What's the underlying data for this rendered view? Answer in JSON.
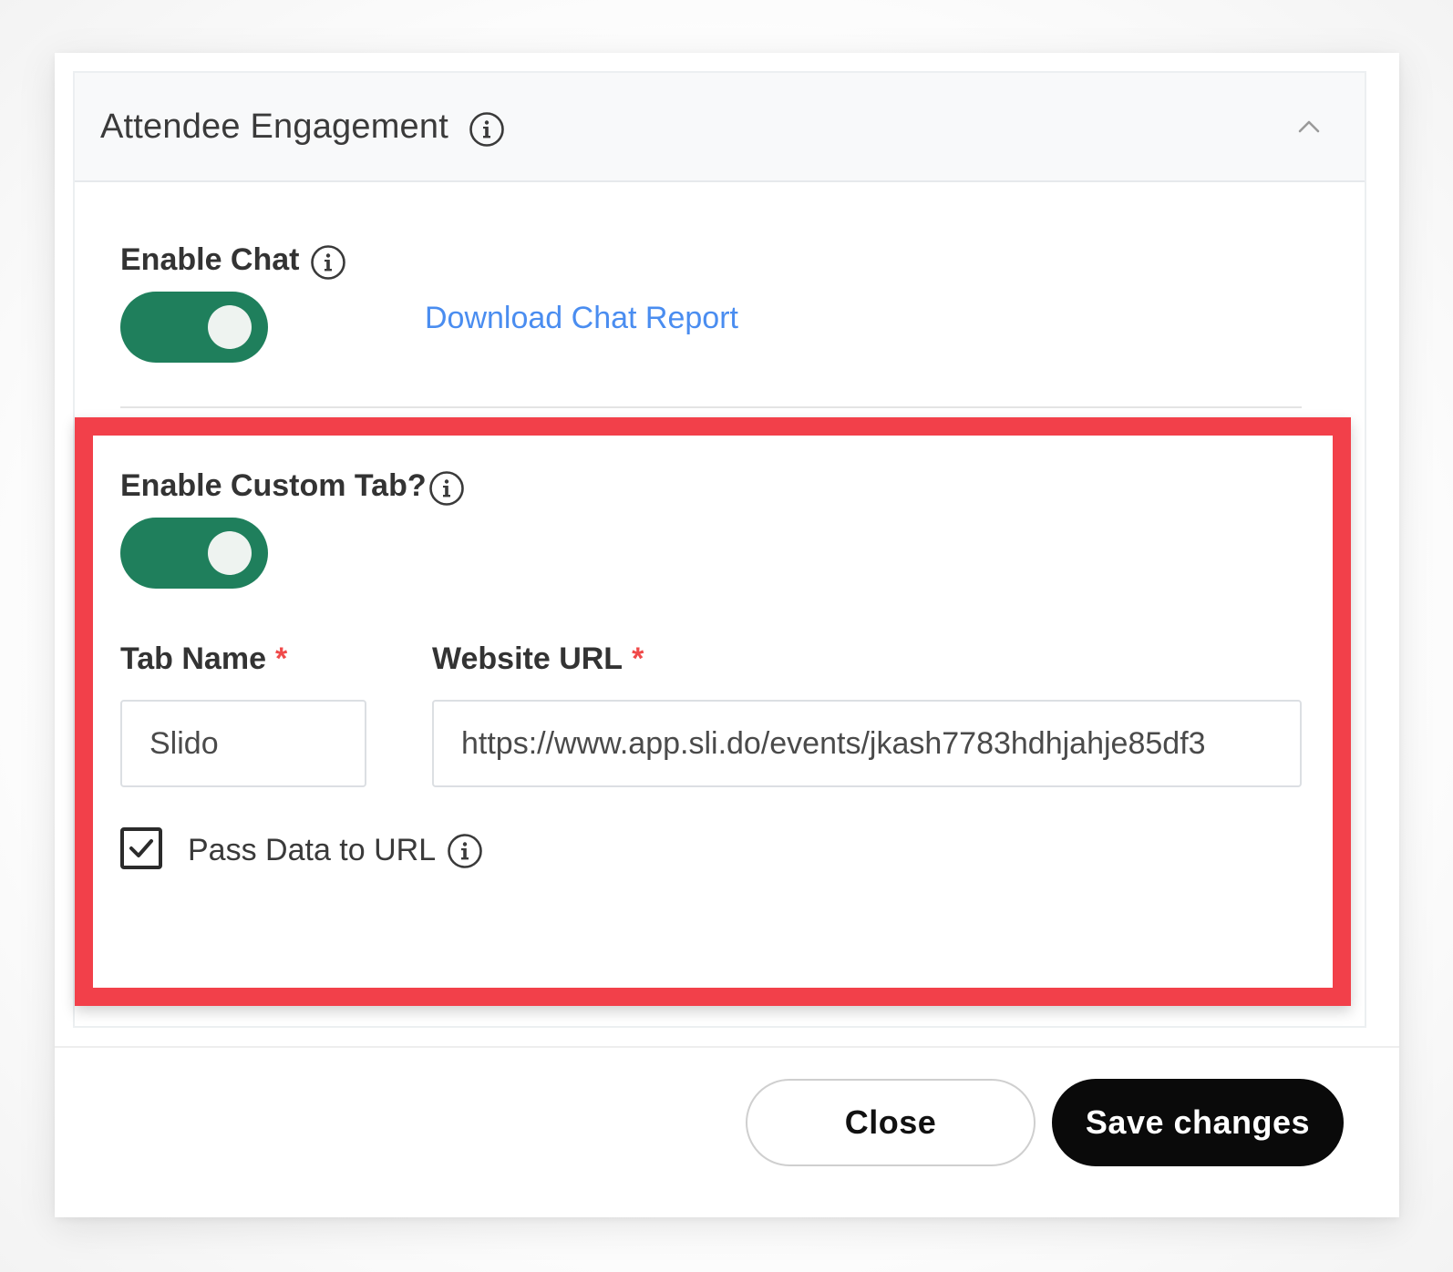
{
  "section": {
    "title": "Attendee Engagement"
  },
  "chat": {
    "label": "Enable Chat",
    "enabled": true,
    "download_link": "Download Chat Report"
  },
  "custom_tab": {
    "label": "Enable Custom Tab?",
    "enabled": true,
    "tab_name_label": "Tab Name",
    "tab_name_value": "Slido",
    "website_url_label": "Website URL",
    "website_url_value": "https://www.app.sli.do/events/jkash7783hdhjahje85df3",
    "required_mark": "*",
    "pass_data_label": "Pass Data to URL",
    "pass_data_checked": true
  },
  "footer": {
    "close_label": "Close",
    "save_label": "Save changes"
  },
  "colors": {
    "toggle_on": "#1f7f5c",
    "link": "#4a8df0",
    "required": "#f04a4a",
    "highlight": "#f2404a",
    "primary_button": "#0a0a0a"
  },
  "icons": {
    "info": "info-icon",
    "chevron": "chevron-up-icon",
    "check": "checkmark-icon"
  }
}
